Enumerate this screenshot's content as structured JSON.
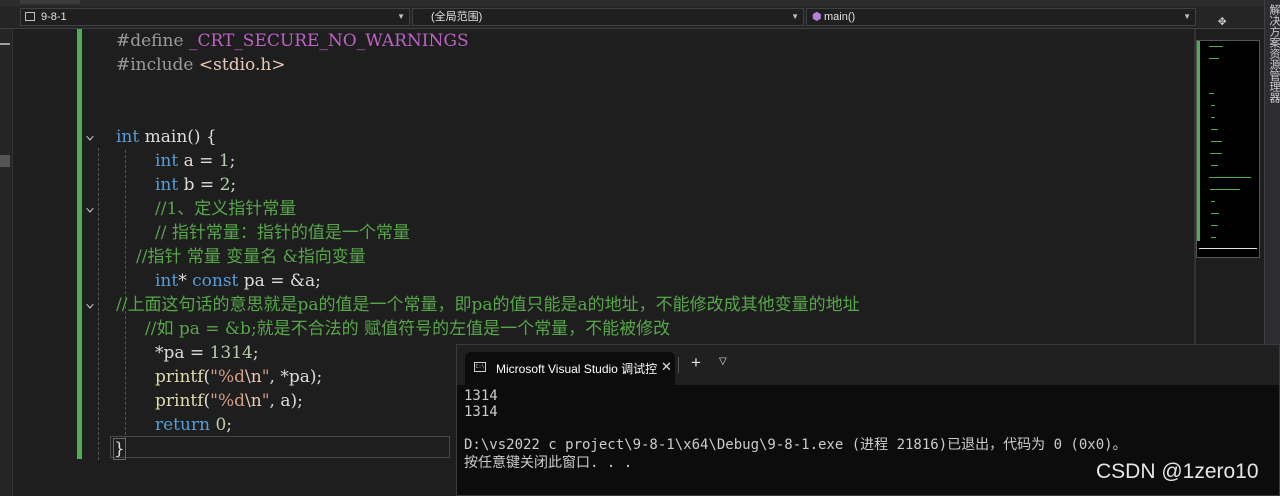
{
  "navbar": {
    "project": "9-8-1",
    "scope": "(全局范围)",
    "function": "main()"
  },
  "code": {
    "l1": [
      "#define",
      "_CRT_SECURE_NO_WARNINGS"
    ],
    "l2": [
      "#include",
      "<stdio.h>"
    ],
    "l5": [
      "int",
      "main() {"
    ],
    "l6": [
      "int",
      "a = ",
      "1",
      ";"
    ],
    "l7": [
      "int",
      "b = ",
      "2",
      ";"
    ],
    "l8": "//1、定义指针常量",
    "l9": "// 指针常量：指针的值是一个常量",
    "l10": "//指针 常量 变量名 &指向变量",
    "l11": [
      "int",
      "* ",
      "const",
      " pa = &a;"
    ],
    "l12": "//上面这句话的意思就是pa的值是一个常量，即pa的值只能是a的地址，不能修改成其他变量的地址",
    "l13": "//如 pa = &b;就是不合法的 赋值符号的左值是一个常量，不能被修改",
    "l14": [
      "*pa = ",
      "1314",
      ";"
    ],
    "l15": [
      "printf",
      "(",
      "\"%d",
      "\\n",
      "\"",
      ", *pa);"
    ],
    "l16": [
      "printf",
      "(",
      "\"%d",
      "\\n",
      "\"",
      ", a);"
    ],
    "l17": [
      "return",
      " ",
      "0",
      ";"
    ],
    "l18": "}"
  },
  "terminal": {
    "title": "Microsoft Visual Studio 调试控",
    "lines": [
      "1314",
      "1314",
      "",
      "D:\\vs2022 c project\\9-8-1\\x64\\Debug\\9-8-1.exe (进程 21816)已退出，代码为 0 (0x0)。",
      "按任意键关闭此窗口. . ."
    ]
  },
  "right_panel": {
    "label": "解决方案资源管理器"
  },
  "watermark": "CSDN @1zero10",
  "colors": {
    "keyword": "#569cd6",
    "comment": "#57a64a",
    "macro": "#bd63c5",
    "change_bar": "#4caf50",
    "editor_bg": "#1e1e1e"
  }
}
